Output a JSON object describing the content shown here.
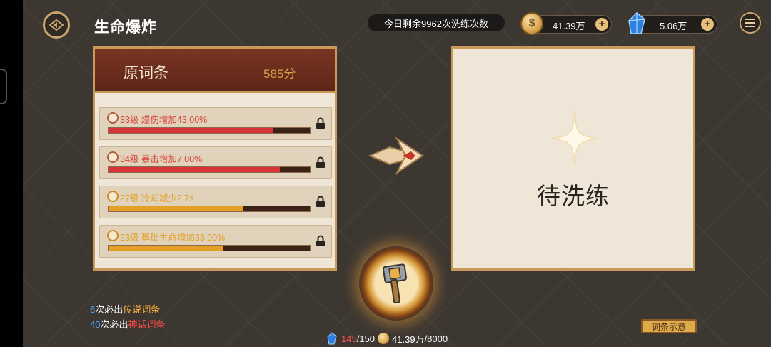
{
  "header": {
    "title": "生命爆炸",
    "refine_remaining": "今日剩余9962次洗练次数",
    "gold_amount": "41.39万",
    "gem_amount": "5.06万",
    "plus_label": "+"
  },
  "original": {
    "heading": "原词条",
    "score": "585分",
    "affixes": [
      {
        "text": "33级 爆伤增加43.00%",
        "color": "red",
        "progress": 0.82
      },
      {
        "text": "34级 暴击增加7.00%",
        "color": "red",
        "progress": 0.85
      },
      {
        "text": "27级 冷却减少2.7s",
        "color": "orange",
        "progress": 0.67
      },
      {
        "text": "23级 基础生命增加33.00%",
        "color": "orange",
        "progress": 0.57
      }
    ]
  },
  "result": {
    "pending_label": "待洗练"
  },
  "guarantee": {
    "legend_count": "6",
    "legend_prefix": "次必出",
    "legend_name": "传说词条",
    "myth_count": "40",
    "myth_prefix": "次必出",
    "myth_name": "神话词条"
  },
  "cost": {
    "gem_current": "145",
    "gem_sep": "/150",
    "gold_current": "41.39万",
    "gold_sep": "/8000"
  },
  "tip_button": "词条示意",
  "colors": {
    "red": "#d9443c",
    "orange": "#e3a024",
    "bar_red": "#d9343a",
    "bar_orange": "#e3a024"
  }
}
